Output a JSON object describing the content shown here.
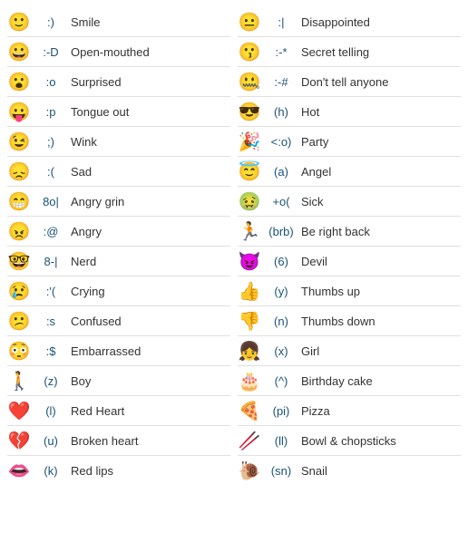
{
  "left_col": [
    {
      "emoji": "🙂",
      "code": ":)",
      "label": "Smile"
    },
    {
      "emoji": "😀",
      "code": ":-D",
      "label": "Open-mouthed"
    },
    {
      "emoji": "😮",
      "code": ":o",
      "label": "Surprised"
    },
    {
      "emoji": "😛",
      "code": ":p",
      "label": "Tongue out"
    },
    {
      "emoji": "😉",
      "code": ";)",
      "label": "Wink"
    },
    {
      "emoji": "😞",
      "code": ":(",
      "label": "Sad"
    },
    {
      "emoji": "😁",
      "code": "8o|",
      "label": "Angry grin"
    },
    {
      "emoji": "😠",
      "code": ":@",
      "label": "Angry"
    },
    {
      "emoji": "🤓",
      "code": "8-|",
      "label": "Nerd"
    },
    {
      "emoji": "😢",
      "code": ":'(",
      "label": "Crying"
    },
    {
      "emoji": "😕",
      "code": ":s",
      "label": "Confused"
    },
    {
      "emoji": "😳",
      "code": ":$",
      "label": "Embarrassed"
    },
    {
      "emoji": "🚶",
      "code": "(z)",
      "label": "Boy"
    },
    {
      "emoji": "❤️",
      "code": "(l)",
      "label": "Red Heart"
    },
    {
      "emoji": "💔",
      "code": "(u)",
      "label": "Broken heart"
    },
    {
      "emoji": "👄",
      "code": "(k)",
      "label": "Red lips"
    }
  ],
  "right_col": [
    {
      "emoji": "😐",
      "code": ":|",
      "label": "Disappointed"
    },
    {
      "emoji": "😗",
      "code": ":-*",
      "label": "Secret telling"
    },
    {
      "emoji": "🤐",
      "code": ":-#",
      "label": "Don't tell anyone"
    },
    {
      "emoji": "😎",
      "code": "(h)",
      "label": "Hot"
    },
    {
      "emoji": "🎉",
      "code": "<:o)",
      "label": "Party"
    },
    {
      "emoji": "😇",
      "code": "(a)",
      "label": "Angel"
    },
    {
      "emoji": "🤢",
      "code": "+o(",
      "label": "Sick"
    },
    {
      "emoji": "🏃",
      "code": "(brb)",
      "label": "Be right back"
    },
    {
      "emoji": "😈",
      "code": "(6)",
      "label": "Devil"
    },
    {
      "emoji": "👍",
      "code": "(y)",
      "label": "Thumbs up"
    },
    {
      "emoji": "👎",
      "code": "(n)",
      "label": "Thumbs down"
    },
    {
      "emoji": "👧",
      "code": "(x)",
      "label": "Girl"
    },
    {
      "emoji": "🎂",
      "code": "(^)",
      "label": "Birthday cake"
    },
    {
      "emoji": "🍕",
      "code": "(pi)",
      "label": "Pizza"
    },
    {
      "emoji": "🥢",
      "code": "(ll)",
      "label": "Bowl & chopsticks"
    },
    {
      "emoji": "🐌",
      "code": "(sn)",
      "label": "Snail"
    }
  ]
}
